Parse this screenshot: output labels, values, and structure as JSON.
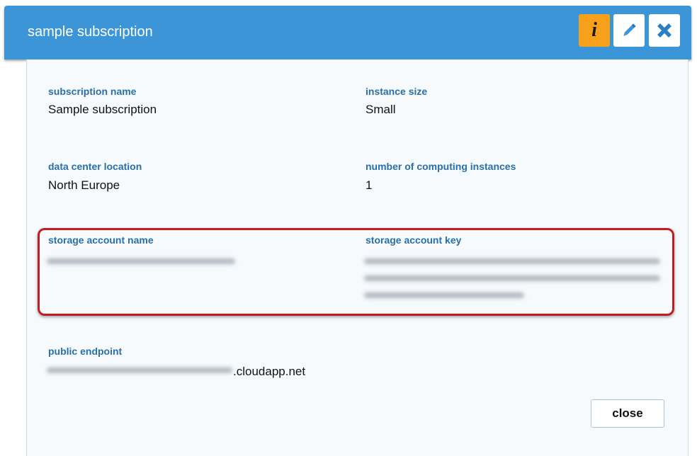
{
  "dialog": {
    "title": "sample subscription",
    "header_buttons": {
      "info_icon": "info-icon",
      "edit_icon": "pencil-icon",
      "close_icon": "close-icon",
      "info_color": "#f7a019"
    }
  },
  "fields": {
    "subscription_name": {
      "label": "subscription name",
      "value": "Sample subscription"
    },
    "instance_size": {
      "label": "instance size",
      "value": "Small"
    },
    "data_center_location": {
      "label": "data center location",
      "value": "North Europe"
    },
    "computing_instances": {
      "label": "number of computing instances",
      "value": "1"
    },
    "storage_account_name": {
      "label": "storage account name"
    },
    "storage_account_key": {
      "label": "storage account key"
    },
    "public_endpoint": {
      "label": "public endpoint",
      "suffix": ".cloudapp.net"
    }
  },
  "footer": {
    "close_label": "close"
  },
  "colors": {
    "header": "#3b95d6",
    "label": "#2a6fa8",
    "highlight": "#c41a22",
    "panel": "#f6fafd"
  }
}
